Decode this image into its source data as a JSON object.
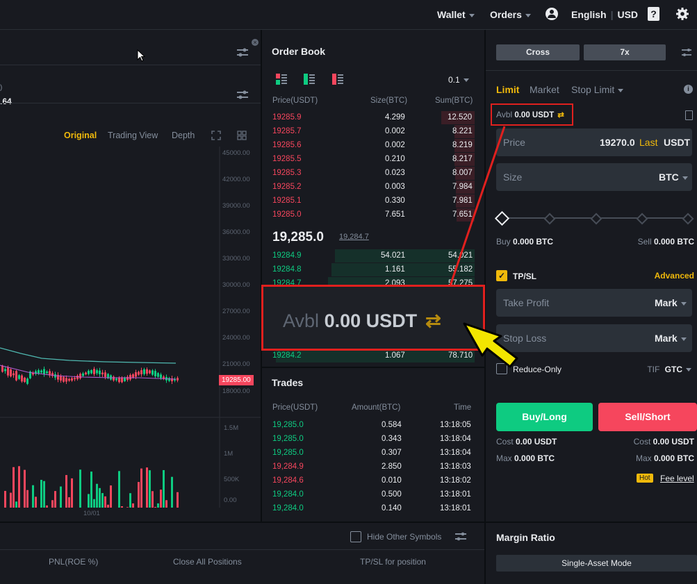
{
  "topbar": {
    "wallet": "Wallet",
    "orders": "Orders",
    "language": "English",
    "currency": "USD"
  },
  "chart": {
    "tabs": [
      "Original",
      "Trading View",
      "Depth"
    ],
    "price_fragment": ".64",
    "price_ticks": [
      "45000.00",
      "42000.00",
      "39000.00",
      "36000.00",
      "33000.00",
      "30000.00",
      "27000.00",
      "24000.00",
      "21000.00",
      "18000.00"
    ],
    "last_price_badge": "19285.00",
    "volume_ticks": [
      "1.5M",
      "1M",
      "500K",
      "0.00"
    ],
    "date_label": "10/01"
  },
  "orderbook": {
    "title": "Order Book",
    "precision": "0.1",
    "headers": [
      "Price(USDT)",
      "Size(BTC)",
      "Sum(BTC)"
    ],
    "asks": [
      {
        "price": "19285.9",
        "size": "4.299",
        "sum": "12.520"
      },
      {
        "price": "19285.7",
        "size": "0.002",
        "sum": "8.221"
      },
      {
        "price": "19285.6",
        "size": "0.002",
        "sum": "8.219"
      },
      {
        "price": "19285.5",
        "size": "0.210",
        "sum": "8.217"
      },
      {
        "price": "19285.3",
        "size": "0.023",
        "sum": "8.007"
      },
      {
        "price": "19285.2",
        "size": "0.003",
        "sum": "7.984"
      },
      {
        "price": "19285.1",
        "size": "0.330",
        "sum": "7.981"
      },
      {
        "price": "19285.0",
        "size": "7.651",
        "sum": "7.651"
      }
    ],
    "last_price": "19,285.0",
    "mark_price": "19,284.7",
    "bids": [
      {
        "price": "19284.9",
        "size": "54.021",
        "sum": "54.021"
      },
      {
        "price": "19284.8",
        "size": "1.161",
        "sum": "55.182"
      },
      {
        "price": "19284.7",
        "size": "2.093",
        "sum": "57.275"
      },
      {
        "price": "19284.2",
        "size": "1.067",
        "sum": "78.710"
      }
    ]
  },
  "trades": {
    "title": "Trades",
    "headers": [
      "Price(USDT)",
      "Amount(BTC)",
      "Time"
    ],
    "rows": [
      {
        "price": "19,285.0",
        "amount": "0.584",
        "time": "13:18:05",
        "side": "buy"
      },
      {
        "price": "19,285.0",
        "amount": "0.343",
        "time": "13:18:04",
        "side": "buy"
      },
      {
        "price": "19,285.0",
        "amount": "0.307",
        "time": "13:18:04",
        "side": "buy"
      },
      {
        "price": "19,284.9",
        "amount": "2.850",
        "time": "13:18:03",
        "side": "sell"
      },
      {
        "price": "19,284.6",
        "amount": "0.010",
        "time": "13:18:02",
        "side": "sell"
      },
      {
        "price": "19,284.0",
        "amount": "0.500",
        "time": "13:18:01",
        "side": "buy"
      },
      {
        "price": "19,284.0",
        "amount": "0.140",
        "time": "13:18:01",
        "side": "buy"
      }
    ]
  },
  "positions_bar": {
    "hide_other": "Hide Other Symbols",
    "pnl": "PNL(ROE %)",
    "close_all": "Close All Positions",
    "tpsl": "TP/SL for position"
  },
  "order_form": {
    "margin_mode": "Cross",
    "leverage": "7x",
    "tabs": [
      "Limit",
      "Market",
      "Stop Limit"
    ],
    "avbl_label": "Avbl",
    "avbl_value": "0.00 USDT",
    "price_label": "Price",
    "price_value": "19270.0",
    "price_last": "Last",
    "price_unit": "USDT",
    "size_label": "Size",
    "size_unit": "BTC",
    "buy_label": "Buy",
    "buy_value": "0.000 BTC",
    "sell_label": "Sell",
    "sell_value": "0.000 BTC",
    "tpsl_label": "TP/SL",
    "advanced": "Advanced",
    "take_profit": "Take Profit",
    "stop_loss": "Stop Loss",
    "mark": "Mark",
    "reduce_only": "Reduce-Only",
    "tif_label": "TIF",
    "tif_value": "GTC",
    "buy_long": "Buy/Long",
    "sell_short": "Sell/Short",
    "cost_label": "Cost",
    "cost_value": "0.00 USDT",
    "max_label": "Max",
    "max_value": "0.000 BTC",
    "hot": "Hot",
    "fee_level": "Fee level",
    "margin_ratio": "Margin Ratio",
    "single_asset": "Single-Asset Mode"
  },
  "zoom_callout": {
    "avbl_label": "Avbl",
    "avbl_value": "0.00 USDT"
  },
  "colors": {
    "background": "#181a20",
    "green": "#0ecb81",
    "red": "#f6465d",
    "gold": "#f0b90b",
    "annotation": "#e0201e"
  }
}
